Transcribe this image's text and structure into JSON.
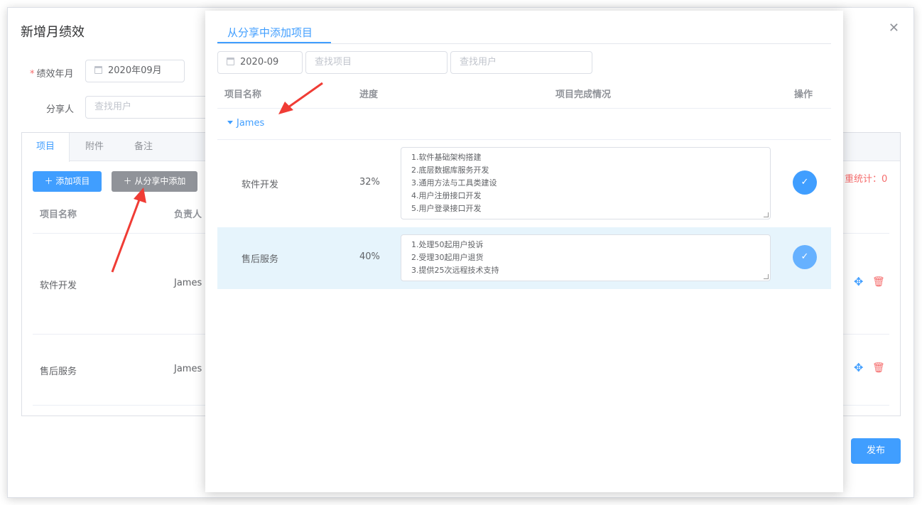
{
  "dialog": {
    "title": "新增月绩效",
    "close_icon": "close-icon",
    "period_label": "绩效年月",
    "period_value": "2020年09月",
    "sharer_label": "分享人",
    "sharer_placeholder": "查找用户",
    "tabs": [
      {
        "label": "项目"
      },
      {
        "label": "附件"
      },
      {
        "label": "备注"
      }
    ],
    "add_project_label": "添加项目",
    "add_from_share_label": "从分享中添加",
    "table_headers": {
      "name": "项目名称",
      "owner": "负责人"
    },
    "rows": [
      {
        "name": "软件开发",
        "owner": "James"
      },
      {
        "name": "售后服务",
        "owner": "James"
      }
    ],
    "stat_text": "重统计：0",
    "publish_label": "发布"
  },
  "overlay": {
    "title": "从分享中添加项目",
    "date_value": "2020-09",
    "search_project_placeholder": "查找项目",
    "search_user_placeholder": "查找用户",
    "headers": {
      "name": "项目名称",
      "progress": "进度",
      "detail": "项目完成情况",
      "action": "操作"
    },
    "group": "James",
    "rows": [
      {
        "name": "软件开发",
        "progress": "32%",
        "lines": [
          "1.软件基础架构搭建",
          "2.底层数据库服务开发",
          "3.通用方法与工具类建设",
          "4.用户注册接口开发",
          "5.用户登录接口开发"
        ]
      },
      {
        "name": "售后服务",
        "progress": "40%",
        "lines": [
          "1.处理50起用户投诉",
          "2.受理30起用户退货",
          "3.提供25次远程技术支持"
        ]
      }
    ]
  },
  "colors": {
    "accent": "#409eff",
    "danger": "#f56c6c",
    "highlight_row": "#e6f4fc",
    "annotation_arrow": "#f03c35"
  }
}
